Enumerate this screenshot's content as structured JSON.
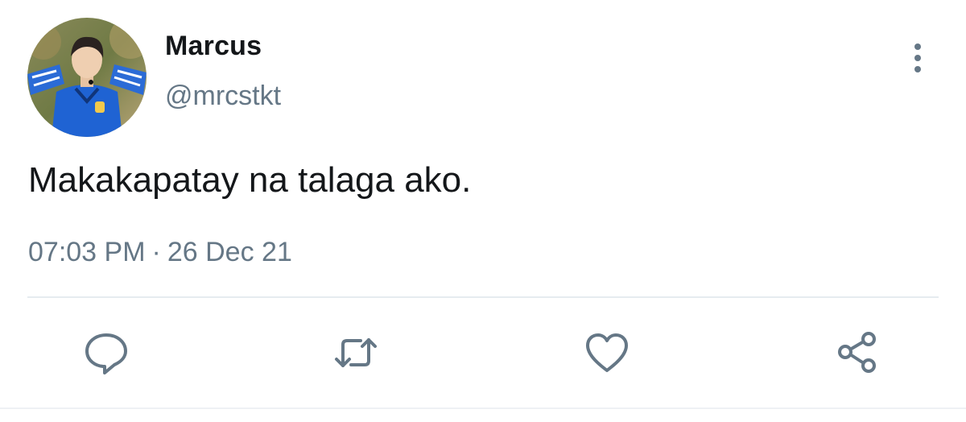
{
  "tweet": {
    "author": {
      "display_name": "Marcus",
      "handle": "@mrcstkt",
      "avatar_icon": "profile-photo"
    },
    "text": "Makakapatay na talaga ako.",
    "time": "07:03 PM",
    "separator": "·",
    "date": "26 Dec 21"
  },
  "actions": {
    "icons": [
      "reply-icon",
      "retweet-icon",
      "like-icon",
      "share-icon"
    ]
  },
  "colors": {
    "primary_text": "#14171a",
    "secondary_text": "#657786",
    "icon": "#657786",
    "divider": "#e6ecf0"
  }
}
